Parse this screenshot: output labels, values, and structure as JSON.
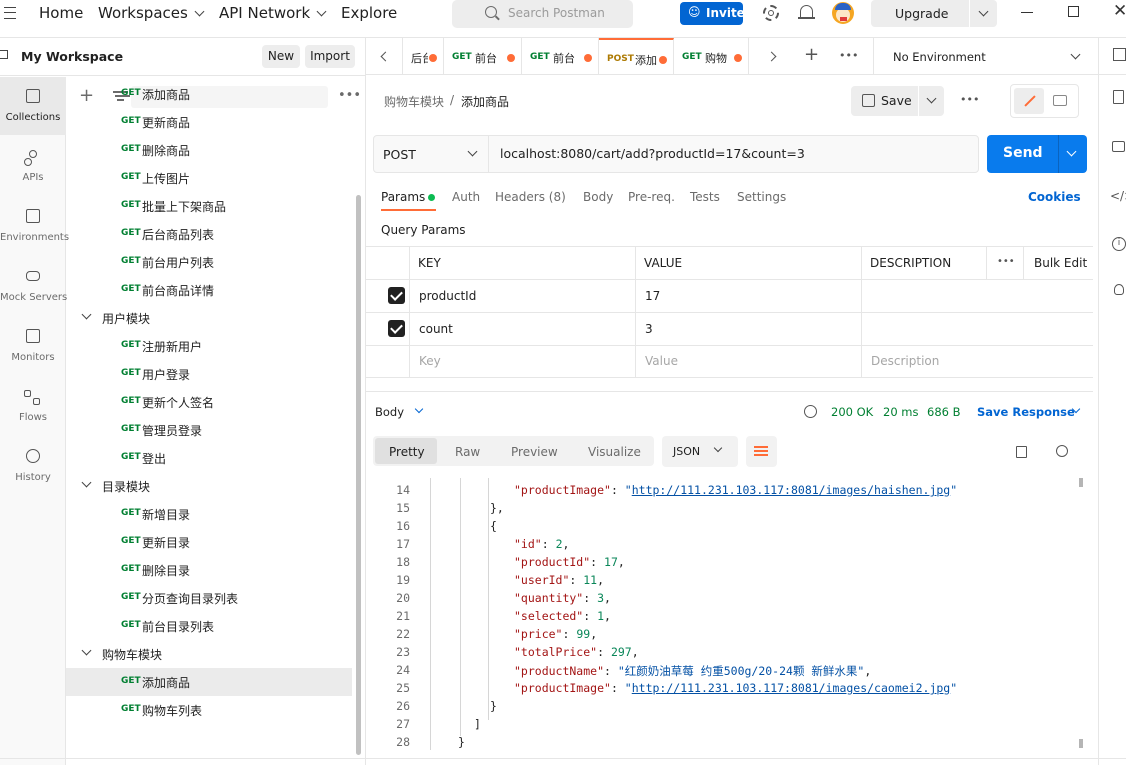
{
  "topbar": {
    "nav": [
      "Home",
      "Workspaces",
      "API Network",
      "Explore"
    ],
    "search_placeholder": "Search Postman",
    "invite_label": "Invite",
    "upgrade_label": "Upgrade"
  },
  "workspace": {
    "name": "My Workspace",
    "new_label": "New",
    "import_label": "Import"
  },
  "rail": [
    {
      "label": "Collections",
      "icon": "collections-icon"
    },
    {
      "label": "APIs",
      "icon": "apis-icon"
    },
    {
      "label": "Environments",
      "icon": "environments-icon"
    },
    {
      "label": "Mock Servers",
      "icon": "mock-servers-icon"
    },
    {
      "label": "Monitors",
      "icon": "monitors-icon"
    },
    {
      "label": "Flows",
      "icon": "flows-icon"
    },
    {
      "label": "History",
      "icon": "history-icon"
    }
  ],
  "tree": [
    {
      "method": "GET",
      "name": "添加商品"
    },
    {
      "method": "GET",
      "name": "更新商品"
    },
    {
      "method": "GET",
      "name": "删除商品"
    },
    {
      "method": "GET",
      "name": "上传图片"
    },
    {
      "method": "GET",
      "name": "批量上下架商品"
    },
    {
      "method": "GET",
      "name": "后台商品列表"
    },
    {
      "method": "GET",
      "name": "前台用户列表"
    },
    {
      "method": "GET",
      "name": "前台商品详情"
    },
    {
      "folder": true,
      "name": "用户模块"
    },
    {
      "method": "GET",
      "name": "注册新用户"
    },
    {
      "method": "GET",
      "name": "用户登录"
    },
    {
      "method": "GET",
      "name": "更新个人签名"
    },
    {
      "method": "GET",
      "name": "管理员登录"
    },
    {
      "method": "GET",
      "name": "登出"
    },
    {
      "folder": true,
      "name": "目录模块"
    },
    {
      "method": "GET",
      "name": "新增目录"
    },
    {
      "method": "GET",
      "name": "更新目录"
    },
    {
      "method": "GET",
      "name": "删除目录"
    },
    {
      "method": "GET",
      "name": "分页查询目录列表"
    },
    {
      "method": "GET",
      "name": "前台目录列表"
    },
    {
      "folder": true,
      "name": "购物车模块"
    },
    {
      "method": "GET",
      "name": "添加商品",
      "selected": true
    },
    {
      "method": "GET",
      "name": "购物车列表"
    }
  ],
  "tabs": [
    {
      "method": "",
      "name": "后台"
    },
    {
      "method": "GET",
      "name": "前台"
    },
    {
      "method": "GET",
      "name": "前台"
    },
    {
      "method": "POST",
      "name": "添加",
      "active": true
    },
    {
      "method": "GET",
      "name": "购物"
    }
  ],
  "environment": "No Environment",
  "breadcrumb": {
    "parent": "购物车模块",
    "separator": "/",
    "current": "添加商品"
  },
  "save_label": "Save",
  "request": {
    "method": "POST",
    "url": "localhost:8080/cart/add?productId=17&count=3",
    "send_label": "Send"
  },
  "param_tabs": [
    "Params",
    "Auth",
    "Headers (8)",
    "Body",
    "Pre-req.",
    "Tests",
    "Settings"
  ],
  "cookies_label": "Cookies",
  "query_params_title": "Query Params",
  "table": {
    "headers": {
      "key": "KEY",
      "value": "VALUE",
      "description": "DESCRIPTION",
      "bulk": "Bulk Edit"
    },
    "rows": [
      {
        "key": "productId",
        "value": "17",
        "checked": true
      },
      {
        "key": "count",
        "value": "3",
        "checked": true
      }
    ],
    "placeholder": {
      "key": "Key",
      "value": "Value",
      "description": "Description"
    }
  },
  "response": {
    "body_label": "Body",
    "status": "200 OK",
    "time": "20 ms",
    "size": "686 B",
    "save_response": "Save Response",
    "view_tabs": [
      "Pretty",
      "Raw",
      "Preview",
      "Visualize"
    ],
    "format": "JSON"
  },
  "code": [
    {
      "n": "14",
      "t": "\"productImage\": \"http://111.231.103.117:8081/images/haishen.jpg\""
    },
    {
      "n": "15",
      "t": "},"
    },
    {
      "n": "16",
      "t": "{"
    },
    {
      "n": "17",
      "t": "\"id\": 2,"
    },
    {
      "n": "18",
      "t": "\"productId\": 17,"
    },
    {
      "n": "19",
      "t": "\"userId\": 11,"
    },
    {
      "n": "20",
      "t": "\"quantity\": 3,"
    },
    {
      "n": "21",
      "t": "\"selected\": 1,"
    },
    {
      "n": "22",
      "t": "\"price\": 99,"
    },
    {
      "n": "23",
      "t": "\"totalPrice\": 297,"
    },
    {
      "n": "24",
      "t": "\"productName\": \"红颜奶油草莓 约重500g/20-24颗 新鲜水果\","
    },
    {
      "n": "25",
      "t": "\"productImage\": \"http://111.231.103.117:8081/images/caomei2.jpg\""
    },
    {
      "n": "26",
      "t": "}"
    },
    {
      "n": "27",
      "t": "]"
    },
    {
      "n": "28",
      "t": "}"
    }
  ],
  "colors": {
    "accent": "#ff6c37",
    "send": "#097bed",
    "get": "#007f31",
    "post": "#ad7a03",
    "invite": "#0265d2"
  }
}
